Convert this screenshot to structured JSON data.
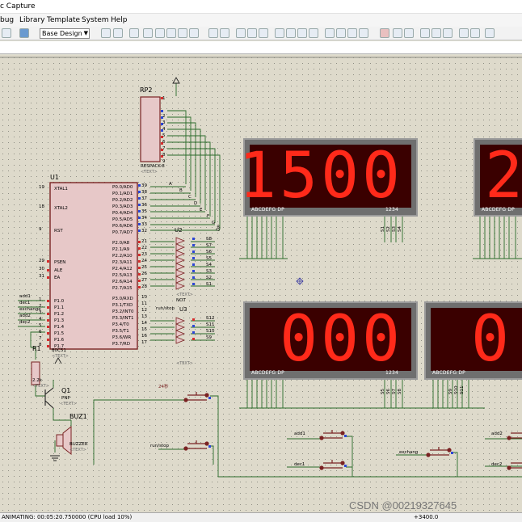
{
  "window": {
    "title": "c Capture"
  },
  "menu": [
    "bug",
    "Library",
    "Template",
    "System",
    "Help"
  ],
  "toolbar": {
    "design_select": "Base Design"
  },
  "status": {
    "text": "ANIMATING: 00:05:20.750000 (CPU load 10%)",
    "coord": "+3400.0",
    "watermark": "CSDN @00219327645"
  },
  "u1": {
    "ref": "U1",
    "part": "80C51",
    "text": "<TEXT>",
    "left_pins": [
      {
        "num": "19",
        "name": "XTAL1"
      },
      {
        "num": "18",
        "name": "XTAL2"
      },
      {
        "num": "9",
        "name": "RST"
      },
      {
        "num": "29",
        "name": "PSEN"
      },
      {
        "num": "30",
        "name": "ALE"
      },
      {
        "num": "31",
        "name": "EA"
      },
      {
        "num": "1",
        "name": "P1.0"
      },
      {
        "num": "2",
        "name": "P1.1"
      },
      {
        "num": "3",
        "name": "P1.2"
      },
      {
        "num": "4",
        "name": "P1.3"
      },
      {
        "num": "5",
        "name": "P1.4"
      },
      {
        "num": "6",
        "name": "P1.5"
      },
      {
        "num": "7",
        "name": "P1.6"
      },
      {
        "num": "8",
        "name": "P1.7"
      }
    ],
    "p0": [
      {
        "num": "39",
        "name": "P0.0/AD0"
      },
      {
        "num": "38",
        "name": "P0.1/AD1"
      },
      {
        "num": "37",
        "name": "P0.2/AD2"
      },
      {
        "num": "36",
        "name": "P0.3/AD3"
      },
      {
        "num": "35",
        "name": "P0.4/AD4"
      },
      {
        "num": "34",
        "name": "P0.5/AD5"
      },
      {
        "num": "33",
        "name": "P0.6/AD6"
      },
      {
        "num": "32",
        "name": "P0.7/AD7"
      }
    ],
    "p2": [
      {
        "num": "21",
        "name": "P2.0/A8"
      },
      {
        "num": "22",
        "name": "P2.1/A9"
      },
      {
        "num": "23",
        "name": "P2.2/A10"
      },
      {
        "num": "24",
        "name": "P2.3/A11"
      },
      {
        "num": "25",
        "name": "P2.4/A12"
      },
      {
        "num": "26",
        "name": "P2.5/A13"
      },
      {
        "num": "27",
        "name": "P2.6/A14"
      },
      {
        "num": "28",
        "name": "P2.7/A15"
      }
    ],
    "p3": [
      {
        "num": "10",
        "name": "P3.0/RXD"
      },
      {
        "num": "11",
        "name": "P3.1/TXD"
      },
      {
        "num": "12",
        "name": "P3.2/INT0"
      },
      {
        "num": "13",
        "name": "P3.3/INT1"
      },
      {
        "num": "14",
        "name": "P3.4/T0"
      },
      {
        "num": "15",
        "name": "P3.5/T1"
      },
      {
        "num": "16",
        "name": "P3.6/WR"
      },
      {
        "num": "17",
        "name": "P3.7/RD"
      }
    ]
  },
  "p1_nets": [
    "add1",
    "dec1",
    "exchange",
    "add2",
    "dec2"
  ],
  "rp2": {
    "ref": "RP2",
    "part": "RESPACK-8",
    "text": "<TEXT>",
    "pins": [
      "1",
      "2",
      "3",
      "4",
      "5",
      "6",
      "7",
      "8",
      "9"
    ],
    "nets": [
      "A",
      "B",
      "C",
      "D",
      "E",
      "F",
      "G",
      "DP"
    ]
  },
  "u2": {
    "ref": "U2",
    "gates": "NOT",
    "text": "<TEXT>",
    "outputs": [
      "S8",
      "S7",
      "S6",
      "S5",
      "S4",
      "S3",
      "S2",
      "S1"
    ]
  },
  "u3": {
    "ref": "U3",
    "text": "<TEXT>",
    "outputs": [
      "S12",
      "S11",
      "S10",
      "S9"
    ],
    "net_in": "run/stop"
  },
  "r1": {
    "ref": "R1",
    "value": "2.2k",
    "text": "<TEXT>"
  },
  "q1": {
    "ref": "Q1",
    "type": "PNP",
    "text": "<TEXT>"
  },
  "buz1": {
    "ref": "BUZ1",
    "part": "BUZZER",
    "text": "<TEXT>"
  },
  "displays": [
    {
      "digits": "1500",
      "seg_pins": "ABCDEFG DP",
      "dig_pins": "1234",
      "sel": [
        "S1",
        "S2",
        "S3",
        "S4"
      ]
    },
    {
      "digits": "2",
      "seg_pins": "ABCDEFG DP",
      "dig_pins": "",
      "sel": []
    },
    {
      "digits": "000",
      "seg_pins": "ABCDEFG DP",
      "dig_pins": "1234",
      "sel": [
        "S5",
        "S6",
        "S7",
        "S8"
      ]
    },
    {
      "digits": "0",
      "seg_pins": "ABCDEFG DP",
      "dig_pins": "",
      "sel": [
        "S9",
        "S10",
        "S11"
      ]
    }
  ],
  "buttons": [
    "24秒",
    "run/stop",
    "add1",
    "dec1",
    "exchang",
    "add2",
    "dec2"
  ]
}
